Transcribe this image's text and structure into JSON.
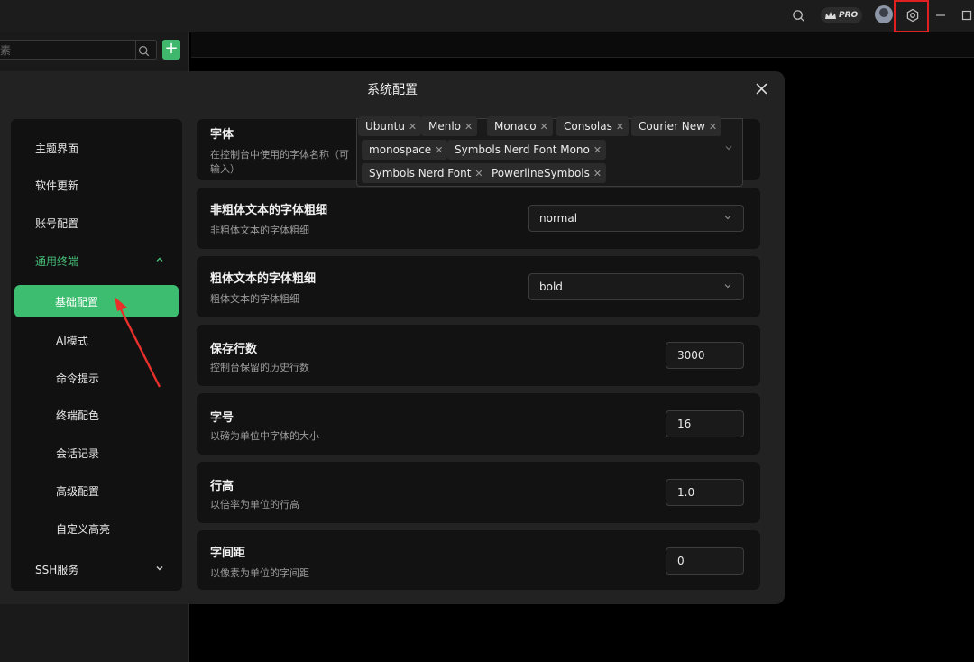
{
  "topbar": {
    "pro_label": "PRO"
  },
  "sidebar": {
    "search_placeholder": "素",
    "add_label": "+"
  },
  "modal": {
    "title": "系统配置",
    "nav": {
      "items": [
        {
          "label": "主题界面"
        },
        {
          "label": "软件更新"
        },
        {
          "label": "账号配置"
        },
        {
          "label": "通用终端"
        },
        {
          "label": "基础配置"
        },
        {
          "label": "AI模式"
        },
        {
          "label": "命令提示"
        },
        {
          "label": "终端配色"
        },
        {
          "label": "会话记录"
        },
        {
          "label": "高级配置"
        },
        {
          "label": "自定义高亮"
        },
        {
          "label": "SSH服务"
        }
      ],
      "active": "基础配置"
    },
    "settings": {
      "font": {
        "title": "字体",
        "desc_line1": "在控制台中使用的字体名称（可",
        "desc_line2": "输入）",
        "tags": [
          "Ubuntu",
          "Menlo",
          "Monaco",
          "Consolas",
          "Courier New",
          "monospace",
          "Symbols Nerd Font Mono",
          "Symbols Nerd Font",
          "PowerlineSymbols"
        ]
      },
      "normal_weight": {
        "title": "非粗体文本的字体粗细",
        "desc": "非粗体文本的字体粗细",
        "value": "normal"
      },
      "bold_weight": {
        "title": "粗体文本的字体粗细",
        "desc": "粗体文本的字体粗细",
        "value": "bold"
      },
      "scrollback": {
        "title": "保存行数",
        "desc": "控制台保留的历史行数",
        "value": "3000"
      },
      "font_size": {
        "title": "字号",
        "desc": "以磅为单位中字体的大小",
        "value": "16"
      },
      "line_height": {
        "title": "行高",
        "desc": "以倍率为单位的行高",
        "value": "1.0"
      },
      "letter_spacing": {
        "title": "字间距",
        "desc": "以像素为单位的字间距",
        "value": "0"
      }
    }
  },
  "colors": {
    "accent": "#3dbd6f",
    "highlight_box": "#e02020",
    "modal_bg": "#222222",
    "card_bg": "#121212"
  }
}
